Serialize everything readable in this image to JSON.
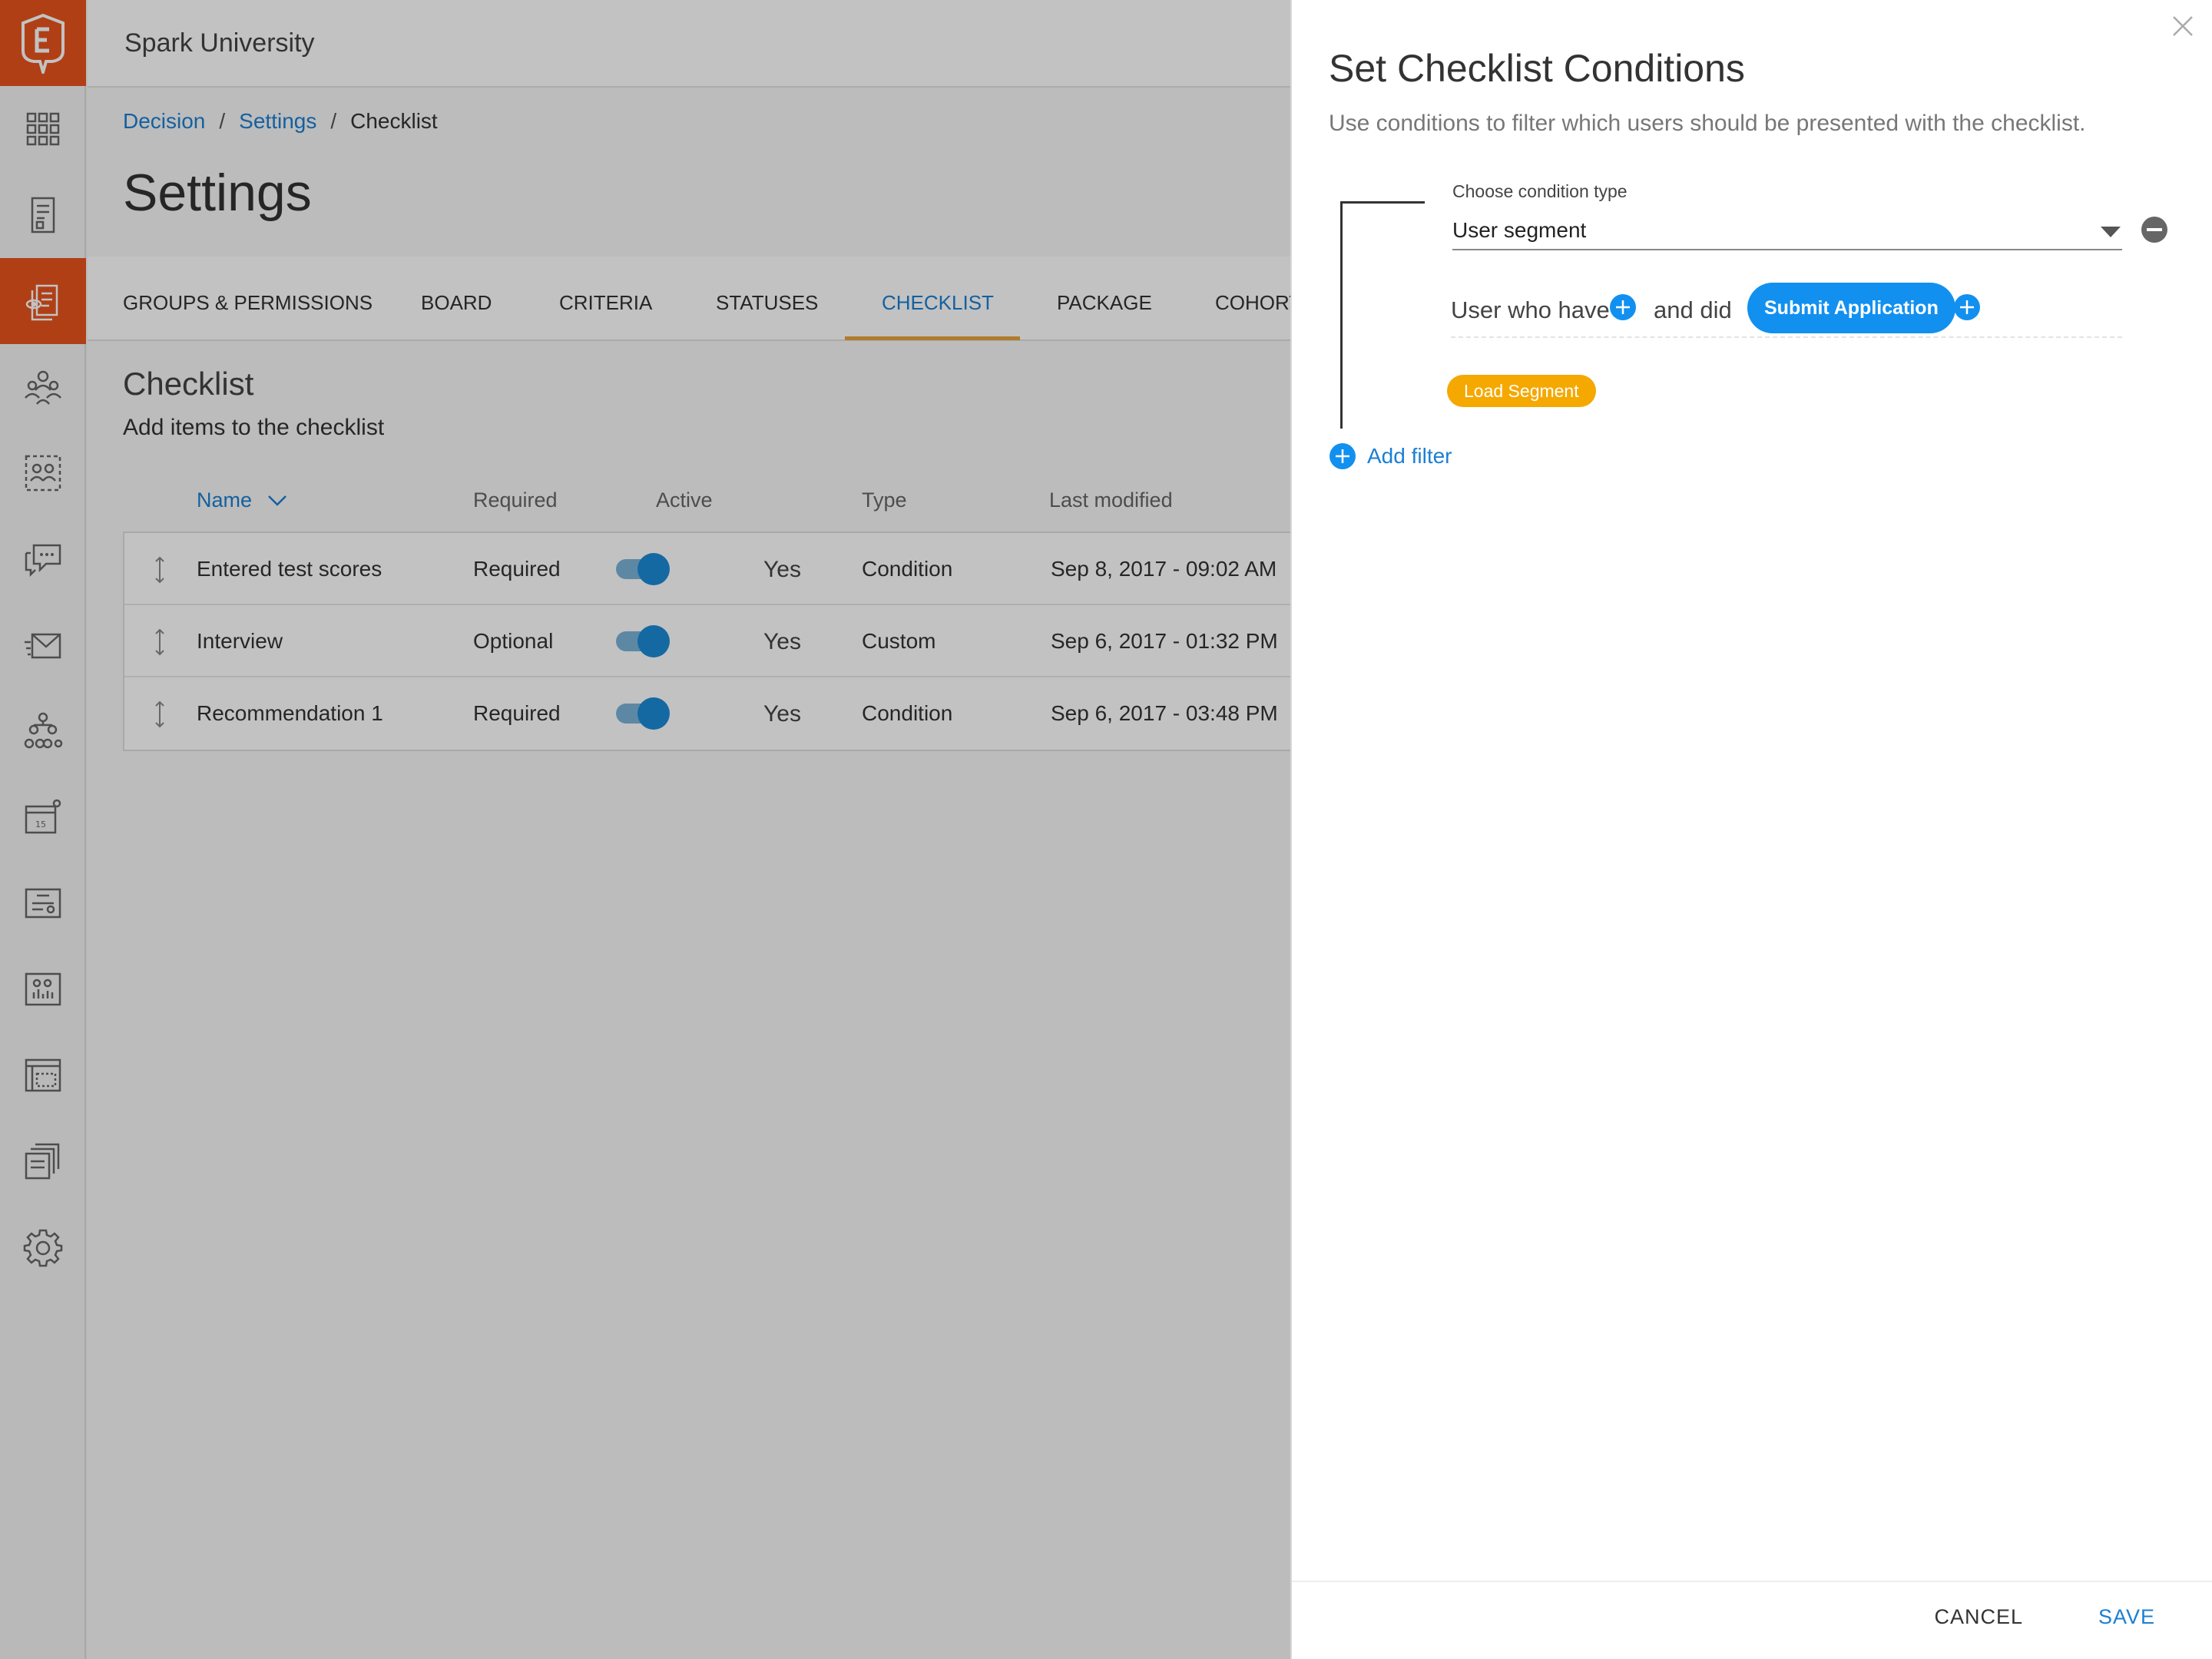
{
  "app": {
    "title": "Spark University"
  },
  "breadcrumb": {
    "items": [
      "Decision",
      "Settings",
      "Checklist"
    ],
    "separator": "/"
  },
  "page": {
    "title": "Settings"
  },
  "tabs": [
    {
      "label": "GROUPS & PERMISSIONS",
      "active": false
    },
    {
      "label": "BOARD",
      "active": false
    },
    {
      "label": "CRITERIA",
      "active": false
    },
    {
      "label": "STATUSES",
      "active": false
    },
    {
      "label": "CHECKLIST",
      "active": true
    },
    {
      "label": "PACKAGE",
      "active": false
    },
    {
      "label": "COHORT",
      "active": false
    }
  ],
  "checklist": {
    "title": "Checklist",
    "subtitle": "Add items to the checklist",
    "columns": [
      "Name",
      "Required",
      "Active",
      "Type",
      "Last modified"
    ],
    "rows": [
      {
        "name": "Entered test scores",
        "required": "Required",
        "active": "Yes",
        "type": "Condition",
        "modified": "Sep 8, 2017 - 09:02 AM"
      },
      {
        "name": "Interview",
        "required": "Optional",
        "active": "Yes",
        "type": "Custom",
        "modified": "Sep 6, 2017 - 01:32 PM"
      },
      {
        "name": "Recommendation 1",
        "required": "Required",
        "active": "Yes",
        "type": "Condition",
        "modified": "Sep 6, 2017 - 03:48 PM"
      }
    ]
  },
  "panel": {
    "title": "Set Checklist Conditions",
    "subtitle": "Use conditions to filter which users should be presented with the checklist.",
    "condition_label": "Choose condition type",
    "condition_value": "User segment",
    "filter": {
      "prefix": "User who have",
      "middle": "and did",
      "event": "Submit Application"
    },
    "segment_button": "Load Segment",
    "add_filter": "Add filter",
    "cancel": "CANCEL",
    "save": "SAVE"
  },
  "sidebar": {
    "icons": [
      "logo-icon",
      "apps-grid-icon",
      "document-icon",
      "review-icon",
      "people-icon",
      "group-icon",
      "chat-icon",
      "mail-icon",
      "hierarchy-icon",
      "calendar-icon",
      "form-icon",
      "report-icon",
      "table-icon",
      "files-icon",
      "gear-icon"
    ],
    "active_index": 3
  },
  "colors": {
    "brand": "#e8541e",
    "link": "#1b7fd3",
    "accent_tab": "#e8a33c",
    "pill_blue": "#1190f0",
    "pill_yellow": "#f5a800"
  }
}
